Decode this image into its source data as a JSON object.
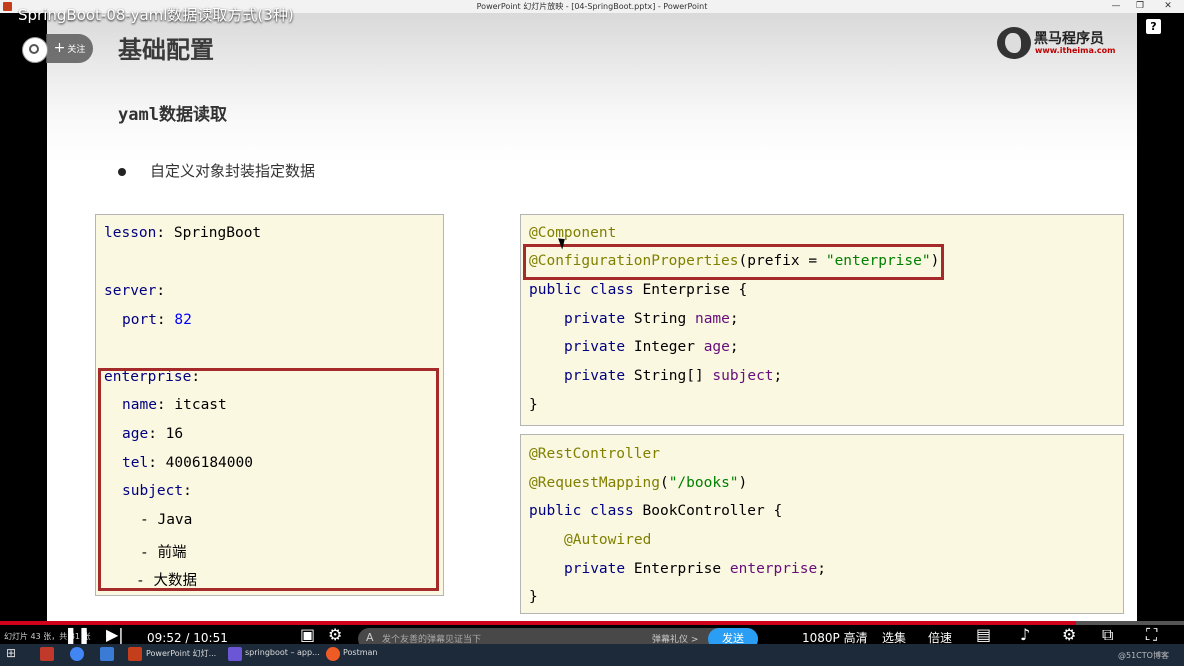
{
  "window": {
    "title": "PowerPoint 幻灯片放映 - [04-SpringBoot.pptx] - PowerPoint"
  },
  "video": {
    "title": "SpringBoot-08-yaml数据读取方式(3种)",
    "follow_label": "关注"
  },
  "slide": {
    "title": "基础配置",
    "subtitle": "yaml数据读取",
    "bullet": "自定义对象封装指定数据",
    "logo": {
      "cn": "黑马程序员",
      "url": "www.itheima.com"
    }
  },
  "yaml": {
    "lesson_key": "lesson",
    "lesson_val": "SpringBoot",
    "server_key": "server",
    "port_key": "port",
    "port_val": "82",
    "ent_key": "enterprise",
    "name_key": "name",
    "name_val": "itcast",
    "age_key": "age",
    "age_val": "16",
    "tel_key": "tel",
    "tel_val": "4006184000",
    "subject_key": "subject",
    "subjects": [
      "Java",
      "前端",
      "大数据"
    ]
  },
  "enterprise_class": {
    "ann1": "@Component",
    "ann2": "@ConfigurationProperties",
    "prefix_kw": "prefix",
    "prefix_val": "\"enterprise\"",
    "decl_kw": "public class",
    "class_name": "Enterprise",
    "f1_type": "String",
    "f1_name": "name",
    "f2_type": "Integer",
    "f2_name": "age",
    "f3_type": "String[]",
    "f3_name": "subject",
    "private_kw": "private"
  },
  "controller_class": {
    "ann1": "@RestController",
    "ann2": "@RequestMapping",
    "mapping_val": "\"/books\"",
    "decl_kw": "public class",
    "class_name": "BookController",
    "ann3": "@Autowired",
    "private_kw": "private",
    "f_type": "Enterprise",
    "f_name": "enterprise"
  },
  "player": {
    "slide_info": "幻灯片 43 张，共 81 张",
    "time_current": "09:52",
    "time_total": "10:51",
    "progress": 0.909,
    "danmu_placeholder": "发个友善的弹幕见证当下",
    "danmu_etiquette": "弹幕礼仪 >",
    "send_label": "发送",
    "quality": "1080P 高清",
    "episodes": "选集",
    "speed": "倍速"
  },
  "taskbar": {
    "items": [
      "PowerPoint 幻灯...",
      "springboot – app...",
      "Postman"
    ],
    "watermark": "@51CTO博客"
  },
  "colors": {
    "accent_red": "#a52a2a",
    "code_bg": "#fbf8e2",
    "progress_red": "#d0021b",
    "send_blue": "#2a9df4"
  }
}
